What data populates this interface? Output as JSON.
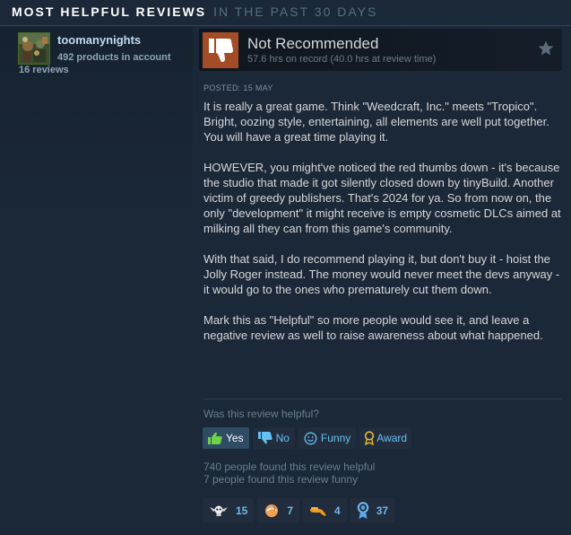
{
  "section_header": {
    "title": "MOST HELPFUL REVIEWS",
    "subtitle": "IN THE PAST 30 DAYS"
  },
  "reviewer": {
    "persona_name": "toomanynights",
    "products_owned": "492 products in account",
    "review_count": "16 reviews"
  },
  "review": {
    "recommendation": "Not Recommended",
    "hours": "57.6 hrs on record (40.0 hrs at review time)",
    "posted": "Posted: 15 May",
    "paragraphs": [
      "It is really a great game. Think \"Weedcraft, Inc.\" meets \"Tropico\". Bright, oozing style, entertaining, all elements are well put together. You will have a great time playing it.",
      "HOWEVER, you might've noticed the red thumbs down - it's because the studio that made it got silently closed down by tinyBuild. Another victim of greedy publishers. That's 2024 for ya. So from now on, the only \"development\" it might receive is empty cosmetic DLCs aimed at milking all they can from this game's community.",
      "With that said, I do recommend playing it, but don't buy it - hoist the Jolly Roger instead. The money would never meet the devs anyway - it would go to the ones who prematurely cut them down.",
      "Mark this as \"Helpful\" so more people would see it, and leave a negative review as well to raise awareness about what happened."
    ]
  },
  "controls": {
    "helpful_question": "Was this review helpful?",
    "yes_label": "Yes",
    "no_label": "No",
    "funny_label": "Funny",
    "award_label": "Award"
  },
  "stats": {
    "helpful": "740 people found this review helpful",
    "funny": "7 people found this review funny"
  },
  "awards": [
    {
      "icon": "winged-skull-icon",
      "count": "15"
    },
    {
      "icon": "hot-take-icon",
      "count": "7"
    },
    {
      "icon": "golden-hand-icon",
      "count": "4"
    },
    {
      "icon": "ribbon-medal-icon",
      "count": "37"
    }
  ],
  "colors": {
    "background": "#1b2838",
    "thumb_down_bg": "#a34c25",
    "link_blue": "#66c0f4",
    "selected_button": "#2e4c64"
  }
}
